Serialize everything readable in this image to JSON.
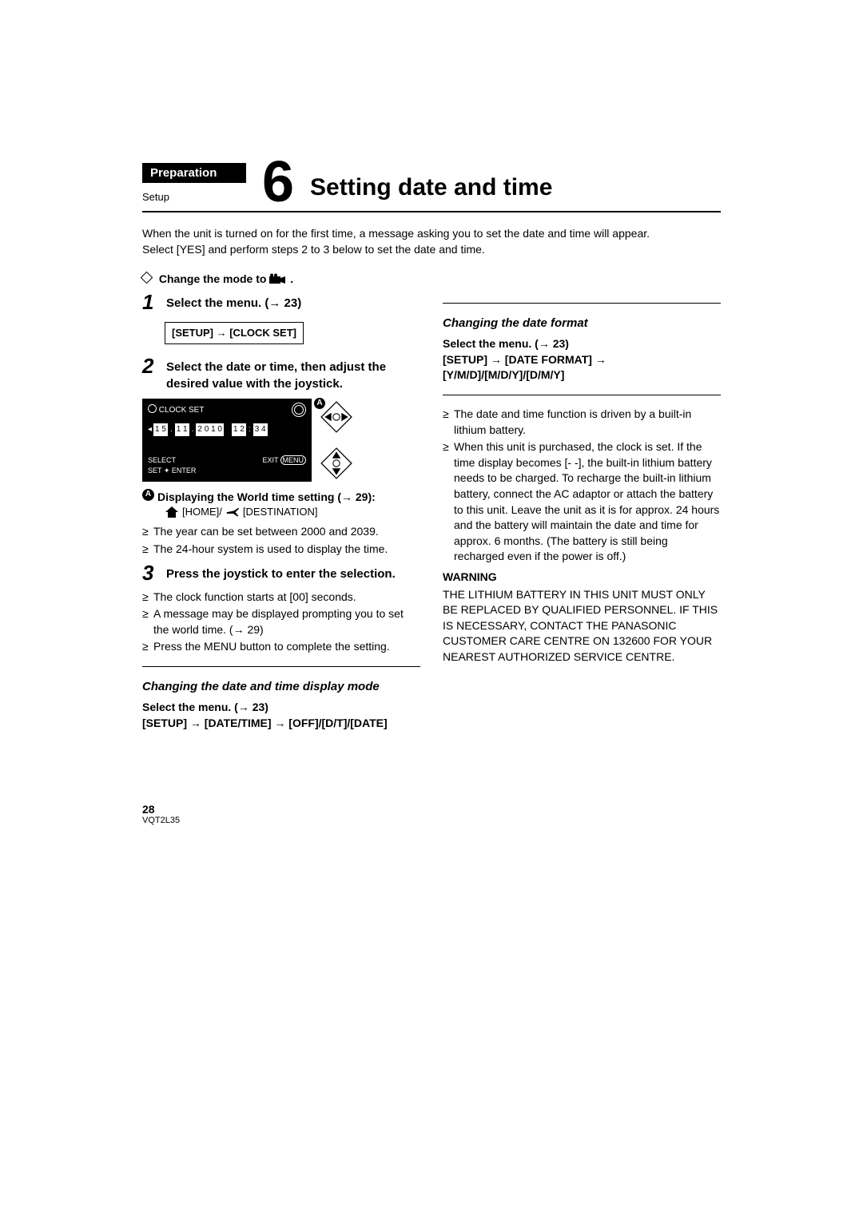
{
  "header": {
    "preparation": "Preparation",
    "setup": "Setup",
    "chapter_number": "6",
    "title": "Setting date and time"
  },
  "intro": {
    "line1": "When the unit is turned on for the first time, a message asking you to set the date and time will appear.",
    "line2": "Select [YES] and perform steps 2 to 3 below to set the date and time."
  },
  "diamond_text": "Change the mode to ",
  "steps": {
    "s1": {
      "num": "1",
      "text": "Select the menu. (→ 23)"
    },
    "menu_path_1": "[SETUP] → [CLOCK SET]",
    "s2": {
      "num": "2",
      "text": "Select the date or time, then adjust the desired value with the joystick."
    },
    "s3": {
      "num": "3",
      "text": "Press the joystick to enter the selection."
    }
  },
  "clockset": {
    "title": "CLOCK SET",
    "cells": [
      "1 5",
      "1 1",
      "2 0 1 0",
      "1 2",
      "3 4"
    ],
    "select": "SELECT",
    "set": "SET",
    "enter": "ENTER",
    "exit": "EXIT",
    "menu": "MENU",
    "callout_letter": "A"
  },
  "world_setting": {
    "label": "Displaying the World time setting (→ 29):",
    "home": "[HOME]/",
    "dest": "[DESTINATION]"
  },
  "left_bullets": {
    "b1": "The year can be set between 2000 and 2039.",
    "b2": "The 24-hour system is used to display the time."
  },
  "after_step3": {
    "b1": "The clock function starts at [00] seconds.",
    "b2": "A message may be displayed prompting you to set the world time. (→ 29)",
    "b3": "Press the MENU button to complete the setting."
  },
  "section_datetime_mode": {
    "heading": "Changing the date and time display mode",
    "line1": "Select the menu. (→ 23)",
    "line2": "[SETUP] → [DATE/TIME] → [OFF]/[D/T]/[DATE]"
  },
  "section_dateformat": {
    "heading": "Changing the date format",
    "line1": "Select the menu. (→ 23)",
    "line2": "[SETUP] → [DATE FORMAT] → [Y/M/D]/[M/D/Y]/[D/M/Y]"
  },
  "right_bullets": {
    "b1": "The date and time function is driven by a built-in lithium battery.",
    "b2": "When this unit is purchased, the clock is set. If the time display becomes [- -], the built-in lithium battery needs to be charged. To recharge the built-in lithium battery, connect the AC adaptor or attach the battery to this unit. Leave the unit as it is for approx. 24 hours and the battery will maintain the date and time for approx. 6 months. (The battery is still being recharged even if the power is off.)"
  },
  "warning": {
    "title": "WARNING",
    "text": "THE LITHIUM BATTERY IN THIS UNIT MUST ONLY BE REPLACED BY QUALIFIED PERSONNEL. IF THIS IS NECESSARY, CONTACT THE PANASONIC CUSTOMER CARE CENTRE ON 132600 FOR YOUR NEAREST AUTHORIZED SERVICE CENTRE."
  },
  "footer": {
    "page": "28",
    "docid": "VQT2L35"
  }
}
